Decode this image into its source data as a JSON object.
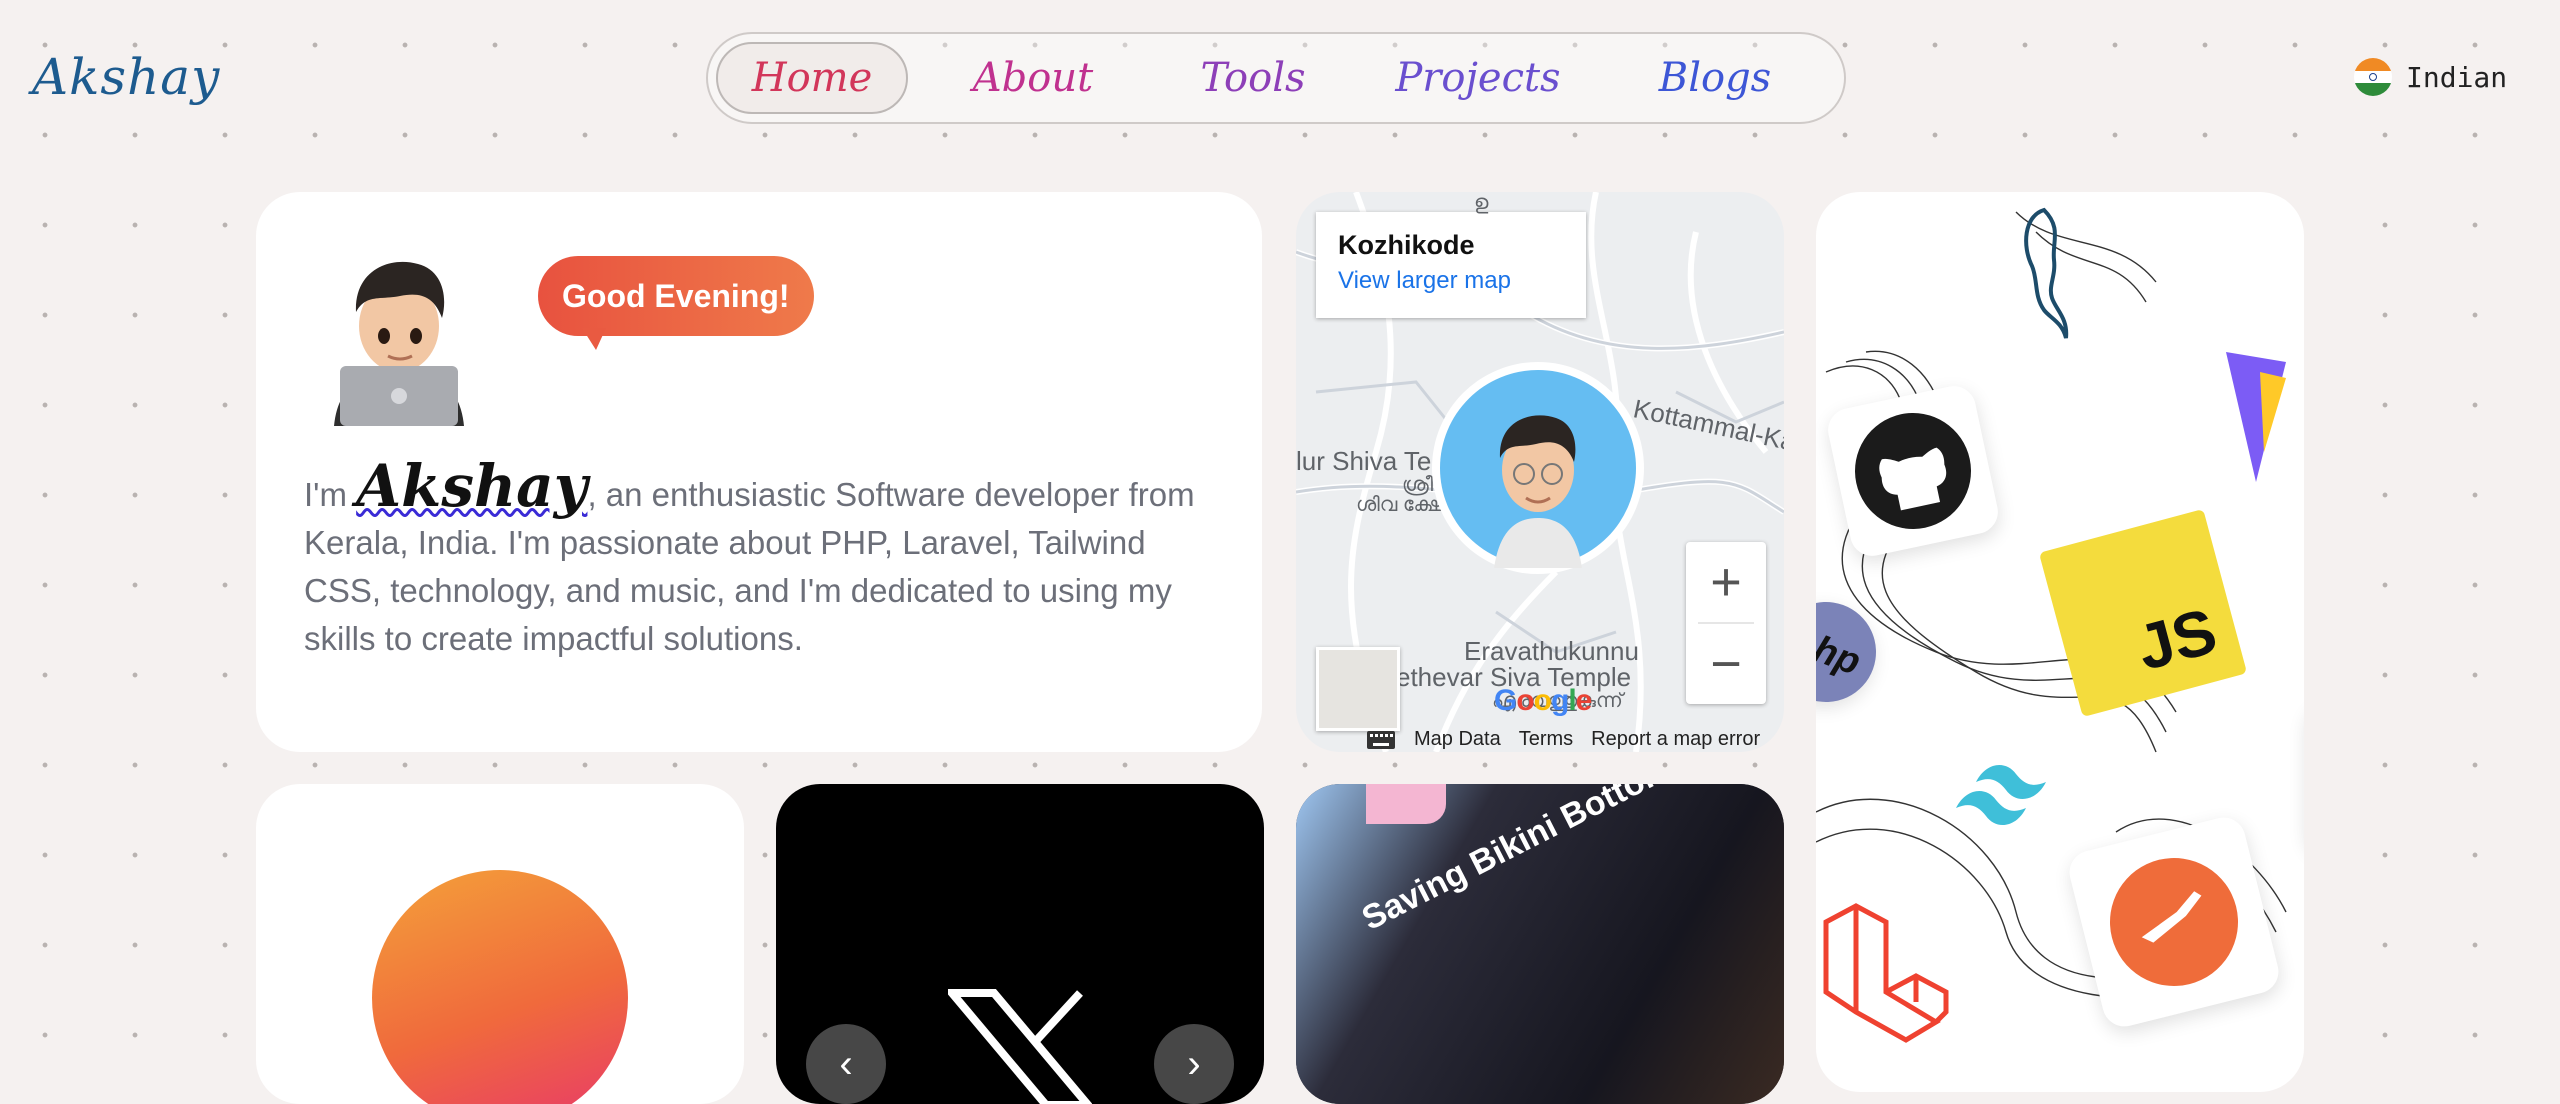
{
  "header": {
    "logo": "Akshay",
    "nav": [
      {
        "label": "Home",
        "color": "#d2365a",
        "active": true
      },
      {
        "label": "About",
        "color": "#c0318f"
      },
      {
        "label": "Tools",
        "color": "#8d3fb8"
      },
      {
        "label": "Projects",
        "color": "#6a4fcf"
      },
      {
        "label": "Blogs",
        "color": "#3d56d6"
      }
    ],
    "language": {
      "label": "Indian",
      "icon": "india-flag-icon"
    }
  },
  "intro": {
    "greeting": "Good Evening!",
    "avatar_icon": "memoji-laptop-avatar",
    "prefix": "I'm",
    "name": "Akshay",
    "bio": ", an enthusiastic Software developer from Kerala, India. I'm passionate about PHP, Laravel, Tailwind CSS, technology, and music, and I'm dedicated to using my skills to create impactful solutions."
  },
  "map": {
    "place_title": "Kozhikode",
    "larger_map_link": "View larger map",
    "labels": {
      "temple_left": "lur Shiva Temple",
      "temple_left_ml1": "ശ്രീ",
      "temple_left_ml2": "ശിവ ക്ഷേ",
      "road": "Kottammal-Ka",
      "area": "Eravathukunnu",
      "temple_bottom": "ethevar Siva Temple",
      "area_ml": "എരവത്തുകുന്ന്",
      "top_ml": "ഉ"
    },
    "zoom_in": "+",
    "zoom_out": "−",
    "footer": {
      "map_data": "Map Data",
      "terms": "Terms",
      "report": "Report a map error"
    },
    "google_logo": "Google"
  },
  "tools": {
    "icons": [
      "mysql-dolphin-icon",
      "github-icon",
      "vite-icon",
      "php-icon",
      "javascript-icon",
      "tailwind-icon",
      "laravel-icon",
      "postman-icon",
      "blue-tool-icon"
    ],
    "js_label": "JS",
    "php_label": "php"
  },
  "cards": {
    "c2_logo_icon": "x-logo-icon",
    "c2_prev_icon": "chevron-left-icon",
    "c2_next_icon": "chevron-right-icon",
    "c3_title": "Saving Bikini Bottom: The Sa"
  }
}
